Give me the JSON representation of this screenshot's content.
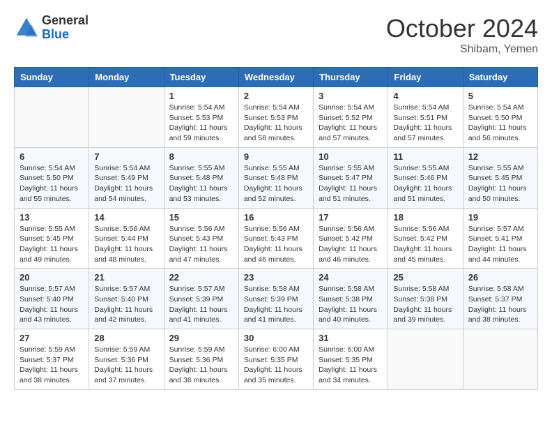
{
  "header": {
    "logo_general": "General",
    "logo_blue": "Blue",
    "month_title": "October 2024",
    "location": "Shibam, Yemen"
  },
  "weekdays": [
    "Sunday",
    "Monday",
    "Tuesday",
    "Wednesday",
    "Thursday",
    "Friday",
    "Saturday"
  ],
  "weeks": [
    [
      {
        "day": "",
        "sunrise": "",
        "sunset": "",
        "daylight": ""
      },
      {
        "day": "",
        "sunrise": "",
        "sunset": "",
        "daylight": ""
      },
      {
        "day": "1",
        "sunrise": "Sunrise: 5:54 AM",
        "sunset": "Sunset: 5:53 PM",
        "daylight": "Daylight: 11 hours and 59 minutes."
      },
      {
        "day": "2",
        "sunrise": "Sunrise: 5:54 AM",
        "sunset": "Sunset: 5:53 PM",
        "daylight": "Daylight: 11 hours and 58 minutes."
      },
      {
        "day": "3",
        "sunrise": "Sunrise: 5:54 AM",
        "sunset": "Sunset: 5:52 PM",
        "daylight": "Daylight: 11 hours and 57 minutes."
      },
      {
        "day": "4",
        "sunrise": "Sunrise: 5:54 AM",
        "sunset": "Sunset: 5:51 PM",
        "daylight": "Daylight: 11 hours and 57 minutes."
      },
      {
        "day": "5",
        "sunrise": "Sunrise: 5:54 AM",
        "sunset": "Sunset: 5:50 PM",
        "daylight": "Daylight: 11 hours and 56 minutes."
      }
    ],
    [
      {
        "day": "6",
        "sunrise": "Sunrise: 5:54 AM",
        "sunset": "Sunset: 5:50 PM",
        "daylight": "Daylight: 11 hours and 55 minutes."
      },
      {
        "day": "7",
        "sunrise": "Sunrise: 5:54 AM",
        "sunset": "Sunset: 5:49 PM",
        "daylight": "Daylight: 11 hours and 54 minutes."
      },
      {
        "day": "8",
        "sunrise": "Sunrise: 5:55 AM",
        "sunset": "Sunset: 5:48 PM",
        "daylight": "Daylight: 11 hours and 53 minutes."
      },
      {
        "day": "9",
        "sunrise": "Sunrise: 5:55 AM",
        "sunset": "Sunset: 5:48 PM",
        "daylight": "Daylight: 11 hours and 52 minutes."
      },
      {
        "day": "10",
        "sunrise": "Sunrise: 5:55 AM",
        "sunset": "Sunset: 5:47 PM",
        "daylight": "Daylight: 11 hours and 51 minutes."
      },
      {
        "day": "11",
        "sunrise": "Sunrise: 5:55 AM",
        "sunset": "Sunset: 5:46 PM",
        "daylight": "Daylight: 11 hours and 51 minutes."
      },
      {
        "day": "12",
        "sunrise": "Sunrise: 5:55 AM",
        "sunset": "Sunset: 5:45 PM",
        "daylight": "Daylight: 11 hours and 50 minutes."
      }
    ],
    [
      {
        "day": "13",
        "sunrise": "Sunrise: 5:55 AM",
        "sunset": "Sunset: 5:45 PM",
        "daylight": "Daylight: 11 hours and 49 minutes."
      },
      {
        "day": "14",
        "sunrise": "Sunrise: 5:56 AM",
        "sunset": "Sunset: 5:44 PM",
        "daylight": "Daylight: 11 hours and 48 minutes."
      },
      {
        "day": "15",
        "sunrise": "Sunrise: 5:56 AM",
        "sunset": "Sunset: 5:43 PM",
        "daylight": "Daylight: 11 hours and 47 minutes."
      },
      {
        "day": "16",
        "sunrise": "Sunrise: 5:56 AM",
        "sunset": "Sunset: 5:43 PM",
        "daylight": "Daylight: 11 hours and 46 minutes."
      },
      {
        "day": "17",
        "sunrise": "Sunrise: 5:56 AM",
        "sunset": "Sunset: 5:42 PM",
        "daylight": "Daylight: 11 hours and 46 minutes."
      },
      {
        "day": "18",
        "sunrise": "Sunrise: 5:56 AM",
        "sunset": "Sunset: 5:42 PM",
        "daylight": "Daylight: 11 hours and 45 minutes."
      },
      {
        "day": "19",
        "sunrise": "Sunrise: 5:57 AM",
        "sunset": "Sunset: 5:41 PM",
        "daylight": "Daylight: 11 hours and 44 minutes."
      }
    ],
    [
      {
        "day": "20",
        "sunrise": "Sunrise: 5:57 AM",
        "sunset": "Sunset: 5:40 PM",
        "daylight": "Daylight: 11 hours and 43 minutes."
      },
      {
        "day": "21",
        "sunrise": "Sunrise: 5:57 AM",
        "sunset": "Sunset: 5:40 PM",
        "daylight": "Daylight: 11 hours and 42 minutes."
      },
      {
        "day": "22",
        "sunrise": "Sunrise: 5:57 AM",
        "sunset": "Sunset: 5:39 PM",
        "daylight": "Daylight: 11 hours and 41 minutes."
      },
      {
        "day": "23",
        "sunrise": "Sunrise: 5:58 AM",
        "sunset": "Sunset: 5:39 PM",
        "daylight": "Daylight: 11 hours and 41 minutes."
      },
      {
        "day": "24",
        "sunrise": "Sunrise: 5:58 AM",
        "sunset": "Sunset: 5:38 PM",
        "daylight": "Daylight: 11 hours and 40 minutes."
      },
      {
        "day": "25",
        "sunrise": "Sunrise: 5:58 AM",
        "sunset": "Sunset: 5:38 PM",
        "daylight": "Daylight: 11 hours and 39 minutes."
      },
      {
        "day": "26",
        "sunrise": "Sunrise: 5:58 AM",
        "sunset": "Sunset: 5:37 PM",
        "daylight": "Daylight: 11 hours and 38 minutes."
      }
    ],
    [
      {
        "day": "27",
        "sunrise": "Sunrise: 5:59 AM",
        "sunset": "Sunset: 5:37 PM",
        "daylight": "Daylight: 11 hours and 38 minutes."
      },
      {
        "day": "28",
        "sunrise": "Sunrise: 5:59 AM",
        "sunset": "Sunset: 5:36 PM",
        "daylight": "Daylight: 11 hours and 37 minutes."
      },
      {
        "day": "29",
        "sunrise": "Sunrise: 5:59 AM",
        "sunset": "Sunset: 5:36 PM",
        "daylight": "Daylight: 11 hours and 36 minutes."
      },
      {
        "day": "30",
        "sunrise": "Sunrise: 6:00 AM",
        "sunset": "Sunset: 5:35 PM",
        "daylight": "Daylight: 11 hours and 35 minutes."
      },
      {
        "day": "31",
        "sunrise": "Sunrise: 6:00 AM",
        "sunset": "Sunset: 5:35 PM",
        "daylight": "Daylight: 11 hours and 34 minutes."
      },
      {
        "day": "",
        "sunrise": "",
        "sunset": "",
        "daylight": ""
      },
      {
        "day": "",
        "sunrise": "",
        "sunset": "",
        "daylight": ""
      }
    ]
  ]
}
